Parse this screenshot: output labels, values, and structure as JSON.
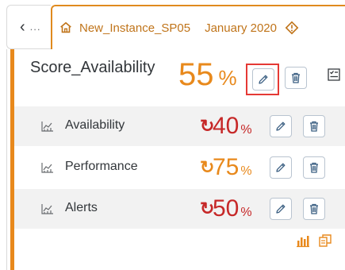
{
  "colors": {
    "accent": "#e8891c",
    "good": "#e8891c",
    "bad": "#c62828",
    "highlight": "#e53935"
  },
  "topbar": {
    "back_icon": "chevron-left-icon",
    "more_label": "∙∙∙",
    "tab": {
      "icon": "home-icon",
      "title": "New_Instance_SP05",
      "period": "January 2020",
      "status_icon": "warning-icon"
    }
  },
  "card": {
    "main": {
      "title": "Score_Availability",
      "value": "55",
      "unit": "%",
      "edit_icon": "pencil-icon",
      "delete_icon": "trash-icon",
      "side_icon": "checklist-icon"
    },
    "rows": [
      {
        "label": "Availability",
        "trend_icon": "refresh-icon",
        "value": "40",
        "unit": "%",
        "status": "bad"
      },
      {
        "label": "Performance",
        "trend_icon": "refresh-icon",
        "value": "75",
        "unit": "%",
        "status": "good"
      },
      {
        "label": "Alerts",
        "trend_icon": "refresh-icon",
        "value": "50",
        "unit": "%",
        "status": "bad"
      }
    ],
    "footer": {
      "chart_icon": "bar-chart-icon",
      "copy_icon": "copy-icon"
    }
  }
}
